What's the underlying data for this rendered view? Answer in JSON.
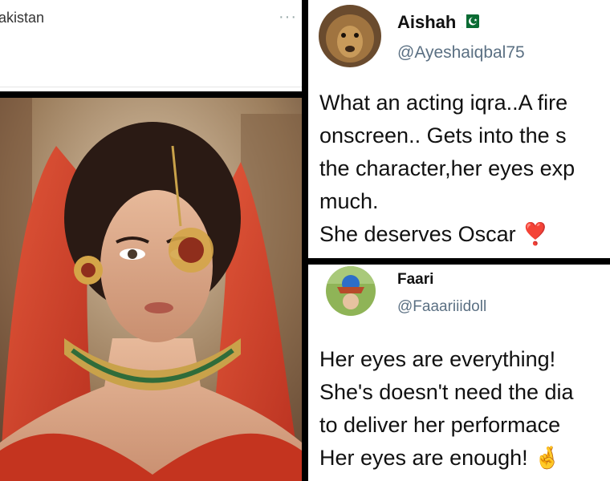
{
  "top_left_card": {
    "name_partial": "akistan",
    "more_label": "···"
  },
  "tweet_1": {
    "name": "Aishah",
    "flag_icon": "pakistan-flag-icon",
    "handle": "@Ayeshaiqbal75",
    "lines": [
      "What an acting iqra..A fire",
      "onscreen.. Gets into the s",
      "the character,her eyes exp",
      "much.",
      "She deserves Oscar"
    ],
    "heart_emoji": "❣️"
  },
  "tweet_2": {
    "name": "Faari",
    "handle": "@Faaariiidoll",
    "lines": [
      "Her eyes are everything!",
      "She's doesn't need the dia",
      "to deliver her performace",
      "Her eyes are enough!"
    ],
    "fingers_emoji": "🤞"
  },
  "colors": {
    "divider": "#000000",
    "handle_gray": "#5b7083",
    "flag_green": "#0a6b33",
    "heart_red": "#e0102a"
  }
}
